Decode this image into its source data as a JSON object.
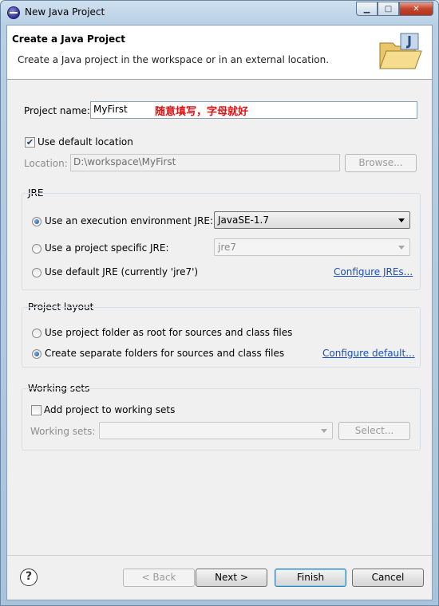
{
  "window": {
    "title": "New Java Project",
    "minimize_glyph": "▁",
    "maximize_glyph": "□",
    "close_glyph": "✕"
  },
  "banner": {
    "title": "Create a Java Project",
    "description": "Create a Java project in the workspace or in an external location."
  },
  "project": {
    "name_label": "Project name:",
    "name_value": "MyFirst",
    "annotation": "随意填写，字母就好",
    "use_default_label": "Use default location",
    "use_default_checked": "✔",
    "location_label": "Location:",
    "location_value": "D:\\workspace\\MyFirst",
    "browse_label": "Browse..."
  },
  "jre": {
    "group_title": "JRE",
    "option_env_label": "Use an execution environment JRE:",
    "env_value": "JavaSE-1.7",
    "option_specific_label": "Use a project specific JRE:",
    "specific_value": "jre7",
    "option_default_label": "Use default JRE (currently 'jre7')",
    "configure_link": "Configure JREs..."
  },
  "layout": {
    "group_title": "Project layout",
    "option_root_label": "Use project folder as root for sources and class files",
    "option_separate_label": "Create separate folders for sources and class files",
    "configure_link": "Configure default..."
  },
  "working_sets": {
    "group_title": "Working sets",
    "add_label": "Add project to working sets",
    "sets_label": "Working sets:",
    "select_label": "Select..."
  },
  "footer": {
    "help_glyph": "?",
    "back_label": "< Back",
    "next_label": "Next >",
    "finish_label": "Finish",
    "cancel_label": "Cancel"
  },
  "colors": {
    "link": "#1a4fbf",
    "annotation": "#e01010",
    "banner_bg": "#ffffff",
    "dialog_bg": "#f0f0f0"
  },
  "icons": {
    "title": "eclipse-icon",
    "banner": "java-project-folder-icon",
    "help": "help-icon"
  }
}
